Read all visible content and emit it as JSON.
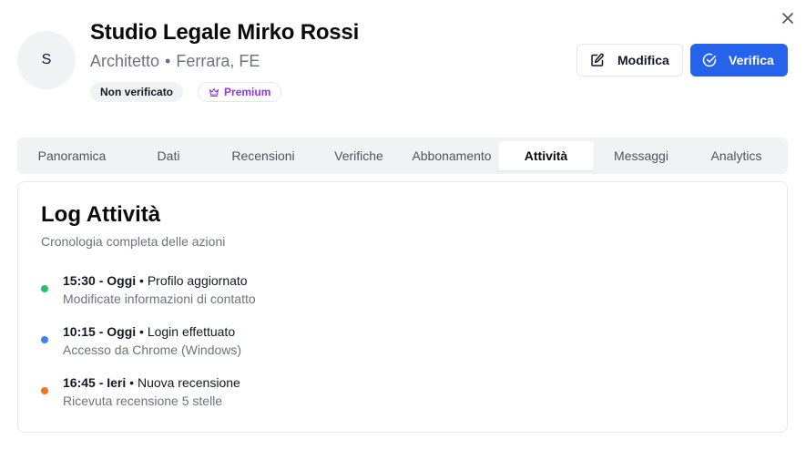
{
  "profile": {
    "avatar_initial": "S",
    "name": "Studio Legale Mirko Rossi",
    "profession": "Architetto",
    "separator": "•",
    "location": "Ferrara, FE",
    "badges": {
      "status": "Non verificato",
      "plan": "Premium"
    }
  },
  "actions": {
    "edit_label": "Modifica",
    "verify_label": "Verifica"
  },
  "tabs": [
    {
      "label": "Panoramica",
      "active": false
    },
    {
      "label": "Dati",
      "active": false
    },
    {
      "label": "Recensioni",
      "active": false
    },
    {
      "label": "Verifiche",
      "active": false
    },
    {
      "label": "Abbonamento",
      "active": false
    },
    {
      "label": "Attività",
      "active": true
    },
    {
      "label": "Messaggi",
      "active": false
    },
    {
      "label": "Analytics",
      "active": false
    }
  ],
  "activity": {
    "title": "Log Attività",
    "description": "Cronologia completa delle azioni",
    "items": [
      {
        "time": "15:30 - Oggi",
        "separator": "•",
        "action": "Profilo aggiornato",
        "detail": "Modificate informazioni di contatto",
        "dot_color": "#22c55e"
      },
      {
        "time": "10:15 - Oggi",
        "separator": "•",
        "action": "Login effettuato",
        "detail": "Accesso da Chrome (Windows)",
        "dot_color": "#3b82f6"
      },
      {
        "time": "16:45 - Ieri",
        "separator": "•",
        "action": "Nuova recensione",
        "detail": "Ricevuta recensione 5 stelle",
        "dot_color": "#f97316"
      }
    ]
  },
  "colors": {
    "primary": "#2563eb",
    "premium": "#9333ea"
  },
  "icons": {
    "close": "close-icon",
    "edit": "edit-icon",
    "verify": "check-circle-icon",
    "premium": "crown-icon"
  }
}
